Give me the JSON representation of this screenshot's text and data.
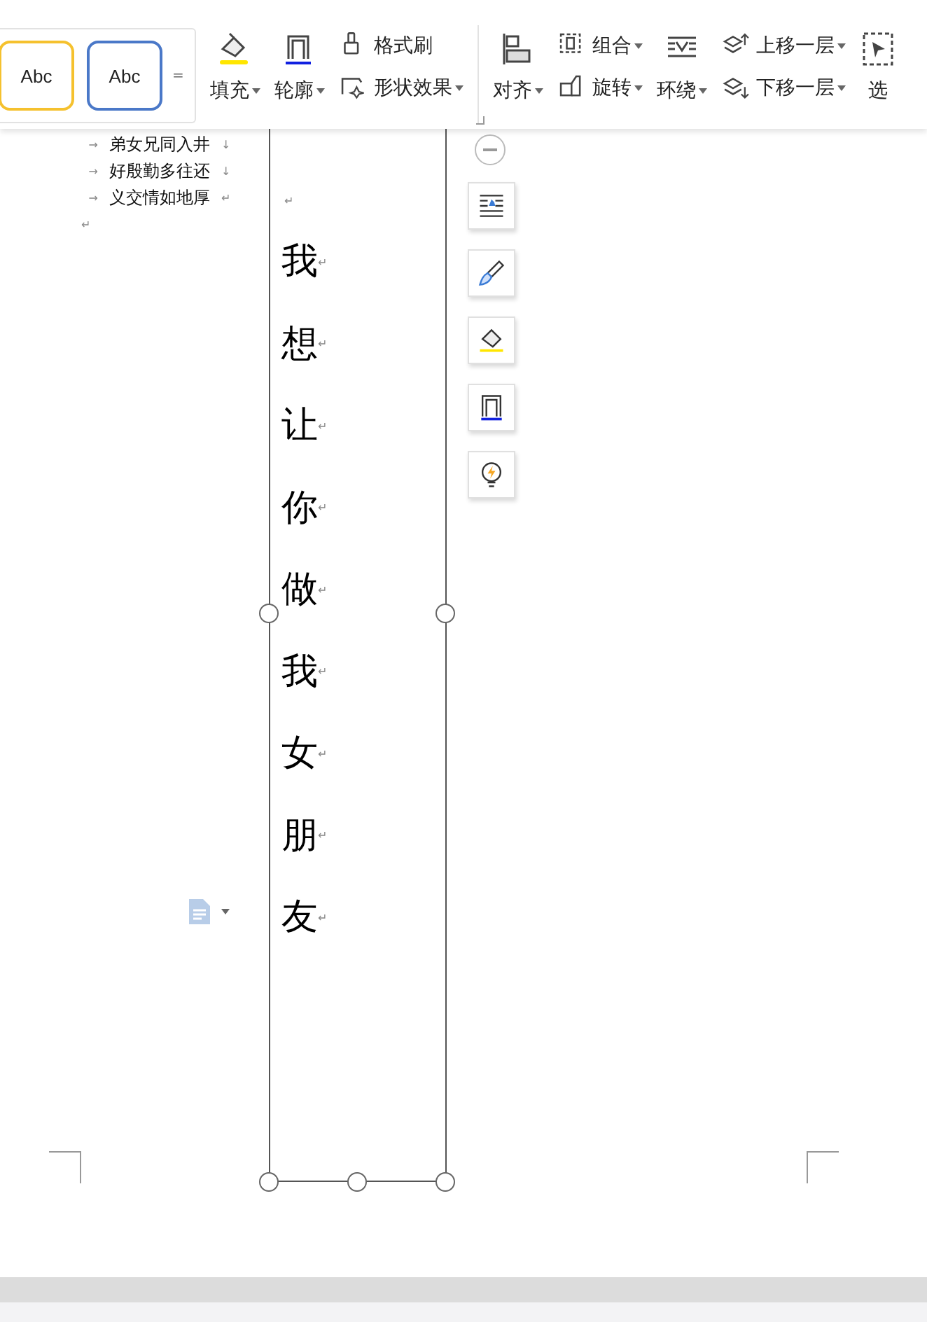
{
  "toolbar": {
    "style_presets": [
      {
        "label": "Abc",
        "color": "#f5c12e"
      },
      {
        "label": "Abc",
        "color": "#4a78c8"
      }
    ],
    "more": "=",
    "columns": [
      {
        "kind": "big",
        "items": [
          {
            "label": "填充",
            "dropdown": true
          }
        ]
      },
      {
        "kind": "big",
        "items": [
          {
            "label": "轮廓",
            "dropdown": true
          }
        ]
      },
      {
        "kind": "stack",
        "items": [
          {
            "label": "格式刷",
            "dropdown": false
          },
          {
            "label": "形状效果",
            "dropdown": true
          }
        ]
      },
      {
        "kind": "divider"
      },
      {
        "kind": "big",
        "items": [
          {
            "label": "对齐",
            "dropdown": true
          }
        ]
      },
      {
        "kind": "stack",
        "items": [
          {
            "label": "组合",
            "dropdown": true
          },
          {
            "label": "旋转",
            "dropdown": true
          }
        ]
      },
      {
        "kind": "big",
        "items": [
          {
            "label": "环绕",
            "dropdown": true
          }
        ]
      },
      {
        "kind": "stack",
        "items": [
          {
            "label": "上移一层",
            "dropdown": true
          },
          {
            "label": "下移一层",
            "dropdown": true
          }
        ]
      },
      {
        "kind": "big",
        "items": [
          {
            "label": "选",
            "dropdown": false
          }
        ]
      }
    ]
  },
  "left_text": [
    {
      "text": "弟女兄同入井",
      "tab": "→",
      "mark": "↓"
    },
    {
      "text": "好殷勤多往还",
      "tab": "→",
      "mark": "↓"
    },
    {
      "text": "义交情如地厚",
      "tab": "→",
      "mark": "↵"
    },
    {
      "mark": "↵"
    }
  ],
  "text_box": {
    "paragraphs": [
      {
        "mark": "↵"
      },
      {
        "text": "我",
        "mark": "↵"
      },
      {
        "text": "想",
        "mark": "↵"
      },
      {
        "text": "让",
        "mark": "↵"
      },
      {
        "text": "你",
        "mark": "↵"
      },
      {
        "text": "做",
        "mark": "↵"
      },
      {
        "text": "我",
        "mark": "↵"
      },
      {
        "text": "女",
        "mark": "↵"
      },
      {
        "text": "朋",
        "mark": "↵"
      },
      {
        "text": "友",
        "mark": "↵"
      }
    ]
  },
  "float_tools": [
    {
      "kind": "layout"
    },
    {
      "kind": "brush"
    },
    {
      "kind": "fill"
    },
    {
      "kind": "outline"
    },
    {
      "kind": "idea"
    }
  ]
}
